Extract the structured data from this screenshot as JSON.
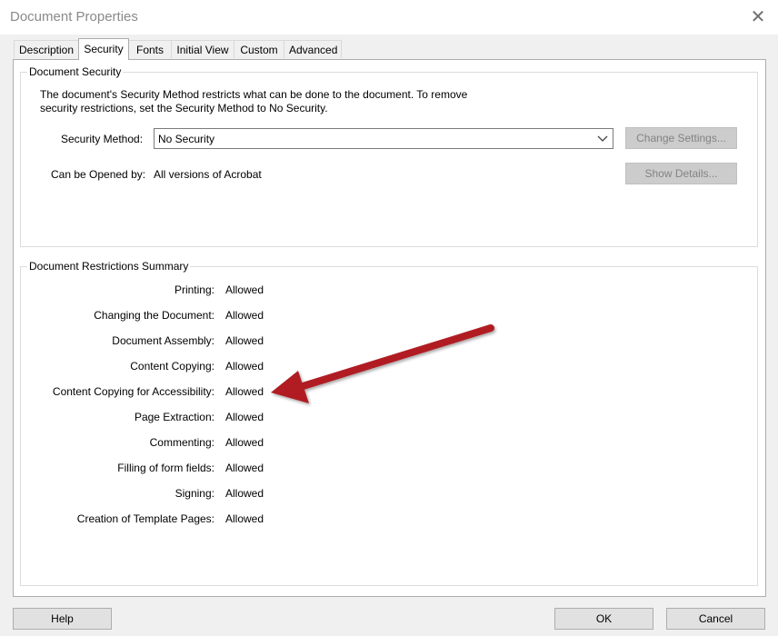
{
  "window": {
    "title": "Document Properties"
  },
  "tabs": [
    {
      "label": "Description"
    },
    {
      "label": "Security"
    },
    {
      "label": "Fonts"
    },
    {
      "label": "Initial View"
    },
    {
      "label": "Custom"
    },
    {
      "label": "Advanced"
    }
  ],
  "active_tab": "Security",
  "security": {
    "group_title": "Document Security",
    "description": "The document's Security Method restricts what can be done to the document. To remove security restrictions, set the Security Method to No Security.",
    "method_label": "Security Method:",
    "method_value": "No Security",
    "change_settings": "Change Settings...",
    "opened_by_label": "Can be Opened by:",
    "opened_by_value": "All versions of Acrobat",
    "show_details": "Show Details..."
  },
  "restrictions": {
    "group_title": "Document Restrictions Summary",
    "items": [
      {
        "label": "Printing:",
        "value": "Allowed"
      },
      {
        "label": "Changing the Document:",
        "value": "Allowed"
      },
      {
        "label": "Document Assembly:",
        "value": "Allowed"
      },
      {
        "label": "Content Copying:",
        "value": "Allowed"
      },
      {
        "label": "Content Copying for Accessibility:",
        "value": "Allowed"
      },
      {
        "label": "Page Extraction:",
        "value": "Allowed"
      },
      {
        "label": "Commenting:",
        "value": "Allowed"
      },
      {
        "label": "Filling of form fields:",
        "value": "Allowed"
      },
      {
        "label": "Signing:",
        "value": "Allowed"
      },
      {
        "label": "Creation of Template Pages:",
        "value": "Allowed"
      }
    ]
  },
  "buttons": {
    "help": "Help",
    "ok": "OK",
    "cancel": "Cancel"
  },
  "colors": {
    "annotation_arrow": "#b01e23"
  }
}
